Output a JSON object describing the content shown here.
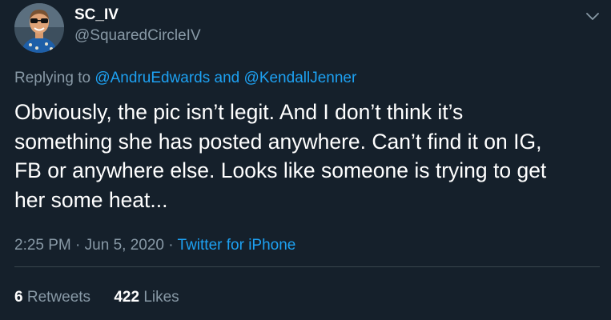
{
  "user": {
    "display_name": "SC_IV",
    "handle": "@SquaredCircleIV"
  },
  "reply": {
    "prefix": "Replying to",
    "mention_1": "@AndruEdwards",
    "joiner": "and",
    "mention_2": "@KendallJenner"
  },
  "tweet": {
    "lines": [
      "Obviously, the pic isn’t legit. And I don’t think it’s",
      "something she has posted anywhere. Can’t find it on IG,",
      "FB or anywhere else. Looks like someone is trying to get",
      "her some heat..."
    ]
  },
  "meta": {
    "time": "2:25 PM",
    "sep": "·",
    "date": "Jun 5, 2020",
    "source": "Twitter for iPhone"
  },
  "stats": {
    "retweets_count": "6",
    "retweets_label": "Retweets",
    "likes_count": "422",
    "likes_label": "Likes"
  },
  "icons": {
    "more": "chevron-down-icon",
    "avatar": "avatar"
  },
  "colors": {
    "background": "#15202b",
    "text_primary": "#ffffff",
    "text_secondary": "#8899a6",
    "link": "#1da1f2",
    "divider": "#38444d"
  }
}
